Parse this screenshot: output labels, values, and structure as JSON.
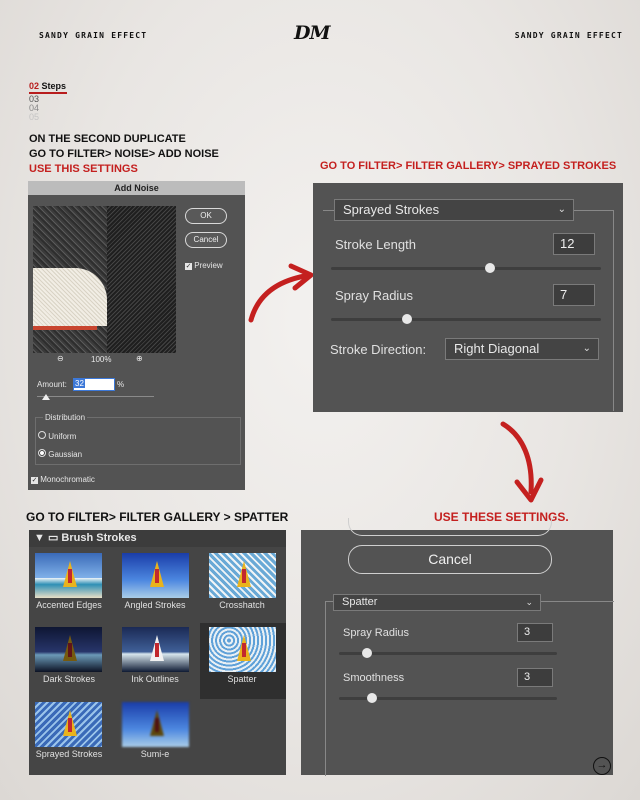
{
  "header": {
    "left_title": "SANDY GRAIN EFFECT",
    "logo": "DM",
    "right_title": "SANDY GRAIN EFFECT"
  },
  "steps": {
    "current_num": "02",
    "current_label": "Steps",
    "next": [
      "03",
      "04",
      "05"
    ]
  },
  "instructions": {
    "line1": "ON THE SECOND DUPLICATE",
    "line2": "GO TO FILTER> NOISE> ADD NOISE",
    "line3": "USE THIS SETTINGS",
    "sprayed_heading": "GO TO FILTER> FILTER GALLERY> SPRAYED STROKES",
    "spatter_heading": "GO TO FILTER> FILTER GALLERY > SPATTER",
    "use_these": "USE THESE SETTINGS."
  },
  "add_noise": {
    "title": "Add Noise",
    "ok_label": "OK",
    "cancel_label": "Cancel",
    "preview_label": "Preview",
    "zoom": "100%",
    "amount_label": "Amount:",
    "amount_value": "32",
    "amount_unit": "%",
    "amount_level": 0.32,
    "distribution_label": "Distribution",
    "uniform_label": "Uniform",
    "gaussian_label": "Gaussian",
    "selected_distribution": "Gaussian",
    "monochromatic_label": "Monochromatic",
    "preview_checked": true,
    "monochromatic_checked": true
  },
  "sprayed_strokes": {
    "filter": "Sprayed Strokes",
    "stroke_length_label": "Stroke Length",
    "stroke_length": "12",
    "spray_radius_label": "Spray Radius",
    "spray_radius": "7",
    "stroke_direction_label": "Stroke Direction:",
    "stroke_direction": "Right Diagonal"
  },
  "gallery": {
    "folder": "Brush Strokes",
    "items": [
      "Accented Edges",
      "Angled Strokes",
      "Crosshatch",
      "Dark Strokes",
      "Ink Outlines",
      "Spatter",
      "Sprayed Strokes",
      "Sumi-e"
    ],
    "selected": "Spatter"
  },
  "spatter": {
    "cancel_label": "Cancel",
    "filter": "Spatter",
    "spray_radius_label": "Spray Radius",
    "spray_radius": "3",
    "smoothness_label": "Smoothness",
    "smoothness": "3"
  },
  "icons": {
    "next": "arrow-right-circle-icon",
    "accent": "#c4201f"
  }
}
